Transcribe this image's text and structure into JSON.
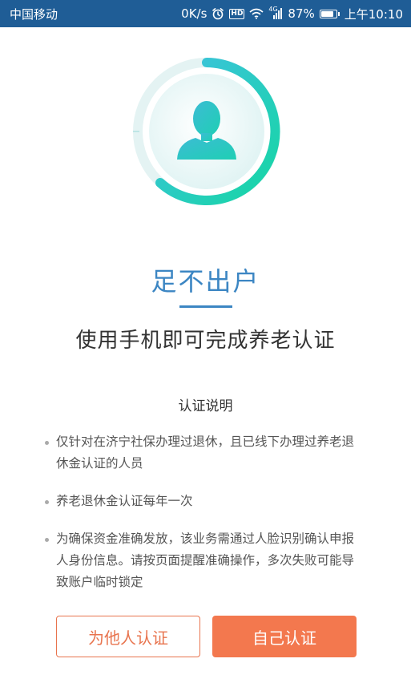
{
  "status_bar": {
    "carrier": "中国移动",
    "speed": "0K/s",
    "network": "4G",
    "hd_label": "HD",
    "battery_percent": "87%",
    "battery_level": 0.87,
    "time": "上午10:10",
    "icons": [
      "alarm-icon",
      "hd-icon",
      "wifi-icon",
      "signal-icon",
      "battery-icon"
    ]
  },
  "hero": {
    "icon": "person-silhouette-icon",
    "colors": {
      "ring_start": "#3fc1e0",
      "ring_end": "#16d6a4",
      "disc": "#e6f5f5"
    }
  },
  "main": {
    "slogan": "足不出户",
    "subtitle": "使用手机即可完成养老认证"
  },
  "notes": {
    "title": "认证说明",
    "items": [
      {
        "text": "仅针对在济宁社保办理过退休，且已线下办理过养老退休金认证的人员"
      },
      {
        "text": "养老退休金认证每年一次"
      },
      {
        "text": "为确保资金准确发放，该业务需通过人脸识别确认申报人身份信息。请按页面提醒准确操作，多次失败可能导致账户临时锁定"
      }
    ]
  },
  "actions": {
    "other_label": "为他人认证",
    "self_label": "自己认证"
  },
  "colors": {
    "status_bar": "#1f5d96",
    "accent_blue": "#3c86c3",
    "accent_orange": "#f3784e"
  }
}
